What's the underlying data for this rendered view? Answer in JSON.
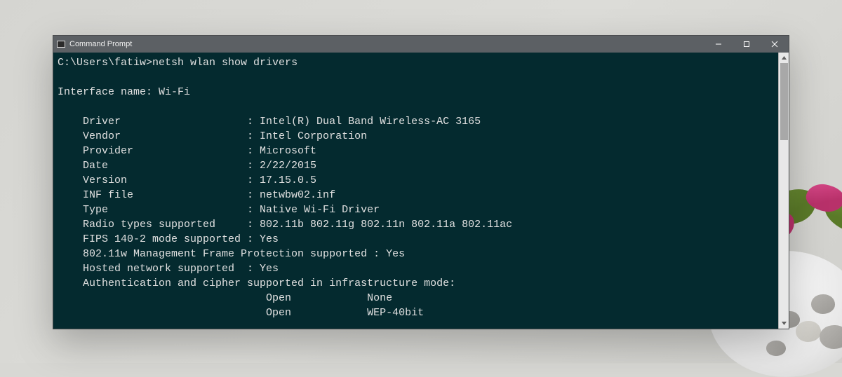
{
  "titlebar": {
    "title": "Command Prompt"
  },
  "terminal": {
    "prompt": "C:\\Users\\fatiw>",
    "command": "netsh wlan show drivers",
    "interface_label": "Interface name: Wi-Fi",
    "fields": {
      "driver": "    Driver                    : Intel(R) Dual Band Wireless-AC 3165",
      "vendor": "    Vendor                    : Intel Corporation",
      "provider": "    Provider                  : Microsoft",
      "date": "    Date                      : 2/22/2015",
      "version": "    Version                   : 17.15.0.5",
      "inf": "    INF file                  : netwbw02.inf",
      "type": "    Type                      : Native Wi-Fi Driver",
      "radio": "    Radio types supported     : 802.11b 802.11g 802.11n 802.11a 802.11ac",
      "fips": "    FIPS 140-2 mode supported : Yes",
      "mgmt": "    802.11w Management Frame Protection supported : Yes",
      "hosted": "    Hosted network supported  : Yes",
      "auth_hdr": "    Authentication and cipher supported in infrastructure mode:",
      "auth1": "                                 Open            None",
      "auth2": "                                 Open            WEP-40bit"
    }
  }
}
